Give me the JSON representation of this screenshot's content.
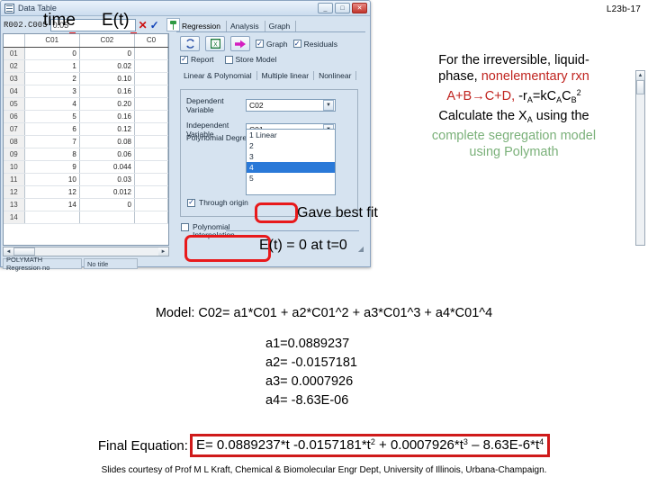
{
  "slide": {
    "number": "L23b-17"
  },
  "annotations": {
    "time_label": "time",
    "et_label": "E(t)",
    "best_fit_note": "Gave best fit",
    "origin_note": "E(t) = 0 at t=0"
  },
  "window": {
    "title": "Data Table",
    "icon": "table-icon",
    "buttons": {
      "minimize": "_",
      "maximize": "□",
      "close": "✕"
    },
    "cell_ref": "R002.C005",
    "cell_value": "0.05",
    "cancel_edit": "✕",
    "accept_edit": "✓",
    "pin": "pin-icon",
    "status": {
      "app": "POLYMATH Regression no",
      "title": "No title"
    }
  },
  "grid": {
    "columns": [
      "C01",
      "C02",
      "C0"
    ],
    "rows": [
      {
        "n": "01",
        "c01": "0",
        "c02": "0"
      },
      {
        "n": "02",
        "c01": "1",
        "c02": "0.02"
      },
      {
        "n": "03",
        "c01": "2",
        "c02": "0.10"
      },
      {
        "n": "04",
        "c01": "3",
        "c02": "0.16"
      },
      {
        "n": "05",
        "c01": "4",
        "c02": "0.20"
      },
      {
        "n": "06",
        "c01": "5",
        "c02": "0.16"
      },
      {
        "n": "07",
        "c01": "6",
        "c02": "0.12"
      },
      {
        "n": "08",
        "c01": "7",
        "c02": "0.08"
      },
      {
        "n": "09",
        "c01": "8",
        "c02": "0.06"
      },
      {
        "n": "10",
        "c01": "9",
        "c02": "0.044"
      },
      {
        "n": "11",
        "c01": "10",
        "c02": "0.03"
      },
      {
        "n": "12",
        "c01": "12",
        "c02": "0.012"
      },
      {
        "n": "13",
        "c01": "14",
        "c02": "0"
      },
      {
        "n": "14",
        "c01": "",
        "c02": ""
      }
    ]
  },
  "regression": {
    "tabs": [
      {
        "label": "Regression",
        "active": true
      },
      {
        "label": "Analysis",
        "active": false
      },
      {
        "label": "Graph",
        "active": false
      }
    ],
    "toolbar_icons": [
      "refresh-icon",
      "excel-icon",
      "arrow-right-icon"
    ],
    "checkboxes": [
      {
        "label": "Graph",
        "checked": true
      },
      {
        "label": "Residuals",
        "checked": true
      },
      {
        "label": "Report",
        "checked": true
      },
      {
        "label": "Store Model",
        "checked": false
      }
    ],
    "subtabs": [
      {
        "label": "Linear & Polynomial",
        "active": true
      },
      {
        "label": "Multiple linear",
        "active": false
      },
      {
        "label": "Nonlinear",
        "active": false
      }
    ],
    "dependent_label": "Dependent Variable",
    "dependent_value": "C02",
    "independent_label": "Independent Variable",
    "independent_value": "C01",
    "degree_label": "Polynomial Degree",
    "degree_options": [
      "1 Linear",
      "2",
      "3",
      "4",
      "5"
    ],
    "degree_selected": "4",
    "through_origin": {
      "label": "Through origin",
      "checked": true
    },
    "polynomial_interpolation": {
      "label_line1": "Polynomial",
      "label_line2": "Interpolation",
      "checked": false
    }
  },
  "problem": {
    "line1": "For the irreversible, liquid-",
    "line2_a": "phase, ",
    "line2_b": "nonelementary rxn",
    "line3_rxn": "A+B→C+D,",
    "line3_rate_pre": "-r",
    "line3_rate_sub1": "A",
    "line3_rate_mid": "=kC",
    "line3_rate_sub2": "A",
    "line3_rate_mid2": "C",
    "line3_rate_sub3": "B",
    "line3_rate_sup": "2",
    "line4_a": "Calculate the X",
    "line4_sub": "A",
    "line4_b": " using the",
    "line5": "complete segregation model",
    "line6": "using Polymath",
    "accent_red": "#c0241f",
    "accent_green": "#7bb17a"
  },
  "results": {
    "model_line": "Model: C02= a1*C01 + a2*C01^2 + a3*C01^3 + a4*C01^4",
    "coefficients": [
      "a1=0.0889237",
      "a2= -0.0157181",
      "a3= 0.0007926",
      "a4= -8.63E-06"
    ],
    "final_label": "Final Equation:",
    "final_eq": {
      "p1": "E= 0.0889237*t -0.0157181*t",
      "s1": "2",
      "p2": " + 0.0007926*t",
      "s2": "3",
      "p3": " – 8.63E-6*t",
      "s3": "4"
    },
    "final_box_color": "#cf1a1a"
  },
  "credit": "Slides courtesy of Prof M L Kraft, Chemical & Biomolecular Engr Dept, University of Illinois, Urbana-Champaign."
}
